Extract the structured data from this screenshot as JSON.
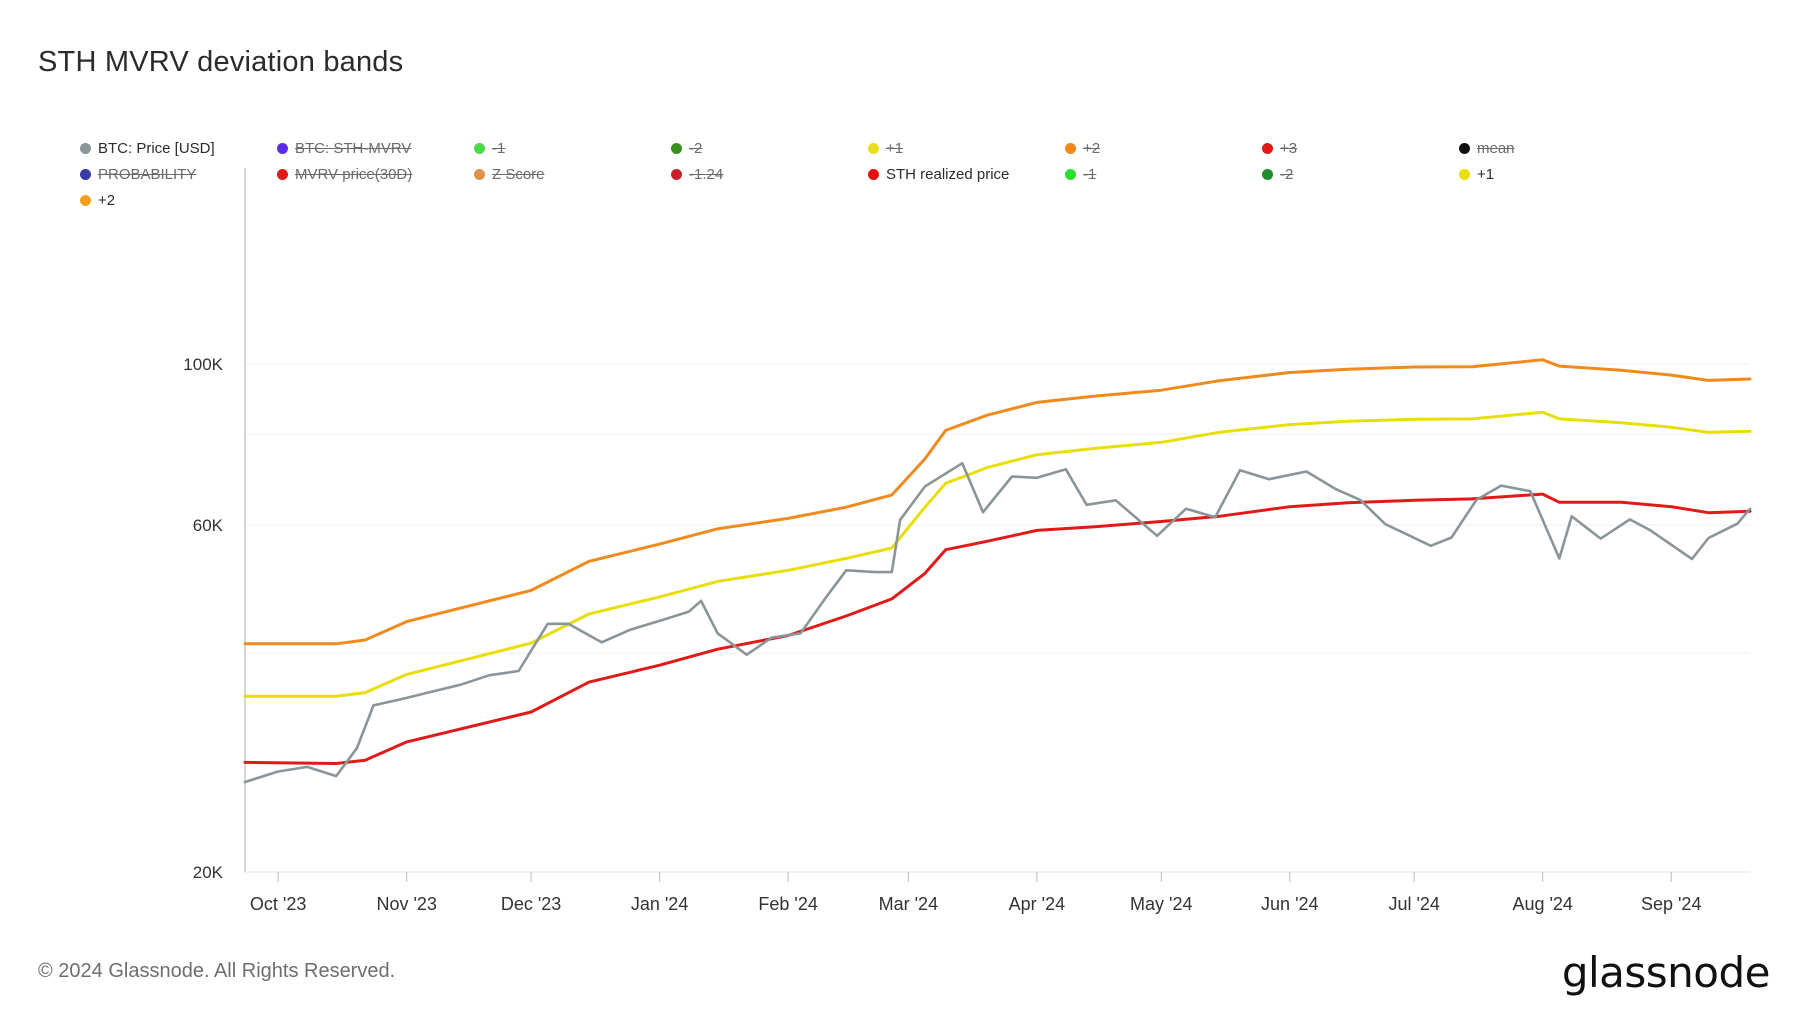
{
  "title": "STH MVRV deviation bands",
  "legend": [
    {
      "label": "BTC: Price [USD]",
      "color": "#8a9599",
      "active": true
    },
    {
      "label": "BTC: STH-MVRV",
      "color": "#5b2de0",
      "active": false
    },
    {
      "label": "-1",
      "color": "#4cd94c",
      "active": false
    },
    {
      "label": "-2",
      "color": "#3a8f1e",
      "active": false
    },
    {
      "label": "+1",
      "color": "#e8de1e",
      "active": false
    },
    {
      "label": "+2",
      "color": "#f08a1c",
      "active": false
    },
    {
      "label": "+3",
      "color": "#e01919",
      "active": false
    },
    {
      "label": "mean",
      "color": "#111111",
      "active": false
    },
    {
      "label": "PROBABILITY",
      "color": "#3a3aa8",
      "active": false
    },
    {
      "label": "MVRV price(30D)",
      "color": "#e01919",
      "active": false
    },
    {
      "label": "Z Score",
      "color": "#e0934a",
      "active": false
    },
    {
      "label": "-1.24",
      "color": "#c9202a",
      "active": false
    },
    {
      "label": "STH realized price",
      "color": "#e80d0d",
      "active": true
    },
    {
      "label": "-1",
      "color": "#2be02b",
      "active": false
    },
    {
      "label": "-2",
      "color": "#1c8f2b",
      "active": false
    },
    {
      "label": "+1",
      "color": "#e8de0a",
      "active": true
    },
    {
      "label": "+2",
      "color": "#f5a01c",
      "active": true
    }
  ],
  "chart_data": {
    "type": "line",
    "title": "STH MVRV deviation bands",
    "y_scale": "log",
    "ylim": [
      20000,
      200000
    ],
    "y_ticks": [
      {
        "value": 20000,
        "label": "20K"
      },
      {
        "value": 60000,
        "label": "60K"
      },
      {
        "value": 100000,
        "label": "100K"
      }
    ],
    "x_ticks": [
      "Oct '23",
      "Nov '23",
      "Dec '23",
      "Jan '24",
      "Feb '24",
      "Mar '24",
      "Apr '24",
      "May '24",
      "Jun '24",
      "Jul '24",
      "Aug '24",
      "Sep '24"
    ],
    "xlim": [
      "2023-09-23",
      "2024-09-20"
    ],
    "grid": true,
    "series": [
      {
        "name": "BTC: Price [USD]",
        "color": "#8a9599",
        "points": [
          [
            "2023-09-23",
            26600
          ],
          [
            "2023-10-01",
            27500
          ],
          [
            "2023-10-08",
            27900
          ],
          [
            "2023-10-15",
            27100
          ],
          [
            "2023-10-20",
            29600
          ],
          [
            "2023-10-24",
            33900
          ],
          [
            "2023-10-31",
            34600
          ],
          [
            "2023-11-07",
            35400
          ],
          [
            "2023-11-14",
            36200
          ],
          [
            "2023-11-21",
            37300
          ],
          [
            "2023-11-28",
            37800
          ],
          [
            "2023-12-05",
            43900
          ],
          [
            "2023-12-10",
            43900
          ],
          [
            "2023-12-18",
            41400
          ],
          [
            "2023-12-25",
            43100
          ],
          [
            "2024-01-01",
            44300
          ],
          [
            "2024-01-08",
            45600
          ],
          [
            "2024-01-11",
            47200
          ],
          [
            "2024-01-15",
            42600
          ],
          [
            "2024-01-22",
            39800
          ],
          [
            "2024-01-28",
            42000
          ],
          [
            "2024-02-04",
            42600
          ],
          [
            "2024-02-10",
            47600
          ],
          [
            "2024-02-15",
            52000
          ],
          [
            "2024-02-22",
            51700
          ],
          [
            "2024-02-26",
            51700
          ],
          [
            "2024-02-28",
            61000
          ],
          [
            "2024-03-05",
            67800
          ],
          [
            "2024-03-14",
            73000
          ],
          [
            "2024-03-19",
            62500
          ],
          [
            "2024-03-26",
            70000
          ],
          [
            "2024-04-01",
            69700
          ],
          [
            "2024-04-08",
            71600
          ],
          [
            "2024-04-13",
            64000
          ],
          [
            "2024-04-20",
            64900
          ],
          [
            "2024-04-30",
            58000
          ],
          [
            "2024-05-07",
            63200
          ],
          [
            "2024-05-14",
            61500
          ],
          [
            "2024-05-20",
            71400
          ],
          [
            "2024-05-27",
            69400
          ],
          [
            "2024-06-05",
            71100
          ],
          [
            "2024-06-12",
            67300
          ],
          [
            "2024-06-18",
            65000
          ],
          [
            "2024-06-24",
            60200
          ],
          [
            "2024-07-05",
            56200
          ],
          [
            "2024-07-10",
            57700
          ],
          [
            "2024-07-16",
            65000
          ],
          [
            "2024-07-22",
            68000
          ],
          [
            "2024-07-29",
            66800
          ],
          [
            "2024-08-05",
            54000
          ],
          [
            "2024-08-08",
            61700
          ],
          [
            "2024-08-15",
            57500
          ],
          [
            "2024-08-22",
            61100
          ],
          [
            "2024-08-27",
            59000
          ],
          [
            "2024-09-06",
            53900
          ],
          [
            "2024-09-10",
            57600
          ],
          [
            "2024-09-17",
            60300
          ],
          [
            "2024-09-20",
            63200
          ]
        ]
      },
      {
        "name": "STH realized price",
        "color": "#e01919",
        "points": [
          [
            "2023-09-23",
            28300
          ],
          [
            "2023-10-15",
            28200
          ],
          [
            "2023-10-22",
            28500
          ],
          [
            "2023-11-01",
            30200
          ],
          [
            "2023-12-01",
            33200
          ],
          [
            "2023-12-15",
            36500
          ],
          [
            "2024-01-01",
            38500
          ],
          [
            "2024-01-15",
            40500
          ],
          [
            "2024-02-01",
            42300
          ],
          [
            "2024-02-15",
            45000
          ],
          [
            "2024-02-26",
            47500
          ],
          [
            "2024-03-05",
            51500
          ],
          [
            "2024-03-10",
            55500
          ],
          [
            "2024-03-20",
            57000
          ],
          [
            "2024-04-01",
            59000
          ],
          [
            "2024-04-15",
            59700
          ],
          [
            "2024-05-01",
            60700
          ],
          [
            "2024-05-15",
            61700
          ],
          [
            "2024-06-01",
            63600
          ],
          [
            "2024-06-15",
            64400
          ],
          [
            "2024-07-01",
            64900
          ],
          [
            "2024-07-15",
            65200
          ],
          [
            "2024-08-01",
            66200
          ],
          [
            "2024-08-05",
            64500
          ],
          [
            "2024-08-20",
            64500
          ],
          [
            "2024-09-01",
            63600
          ],
          [
            "2024-09-10",
            62400
          ],
          [
            "2024-09-20",
            62700
          ]
        ]
      },
      {
        "name": "+1",
        "color": "#e8de0a",
        "points": [
          [
            "2023-09-23",
            34900
          ],
          [
            "2023-10-15",
            34900
          ],
          [
            "2023-10-22",
            35300
          ],
          [
            "2023-11-01",
            37400
          ],
          [
            "2023-12-01",
            41300
          ],
          [
            "2023-12-15",
            45300
          ],
          [
            "2024-01-01",
            47800
          ],
          [
            "2024-01-15",
            50200
          ],
          [
            "2024-02-01",
            52000
          ],
          [
            "2024-02-15",
            54000
          ],
          [
            "2024-02-26",
            55800
          ],
          [
            "2024-03-05",
            63500
          ],
          [
            "2024-03-10",
            68500
          ],
          [
            "2024-03-20",
            72000
          ],
          [
            "2024-04-01",
            75000
          ],
          [
            "2024-04-15",
            76500
          ],
          [
            "2024-05-01",
            78000
          ],
          [
            "2024-05-15",
            80500
          ],
          [
            "2024-06-01",
            82500
          ],
          [
            "2024-06-15",
            83400
          ],
          [
            "2024-07-01",
            83900
          ],
          [
            "2024-07-15",
            84000
          ],
          [
            "2024-08-01",
            85800
          ],
          [
            "2024-08-05",
            84000
          ],
          [
            "2024-08-20",
            83000
          ],
          [
            "2024-09-01",
            81800
          ],
          [
            "2024-09-10",
            80500
          ],
          [
            "2024-09-20",
            80800
          ]
        ]
      },
      {
        "name": "+2",
        "color": "#f08a1c",
        "points": [
          [
            "2023-09-23",
            41200
          ],
          [
            "2023-10-15",
            41200
          ],
          [
            "2023-10-22",
            41700
          ],
          [
            "2023-11-01",
            44200
          ],
          [
            "2023-12-01",
            48800
          ],
          [
            "2023-12-15",
            53500
          ],
          [
            "2024-01-01",
            56500
          ],
          [
            "2024-01-15",
            59300
          ],
          [
            "2024-02-01",
            61300
          ],
          [
            "2024-02-15",
            63500
          ],
          [
            "2024-02-26",
            66000
          ],
          [
            "2024-03-05",
            74000
          ],
          [
            "2024-03-10",
            81000
          ],
          [
            "2024-03-20",
            85000
          ],
          [
            "2024-04-01",
            88500
          ],
          [
            "2024-04-15",
            90300
          ],
          [
            "2024-05-01",
            92000
          ],
          [
            "2024-05-15",
            94800
          ],
          [
            "2024-06-01",
            97300
          ],
          [
            "2024-06-15",
            98300
          ],
          [
            "2024-07-01",
            99000
          ],
          [
            "2024-07-15",
            99100
          ],
          [
            "2024-08-01",
            101300
          ],
          [
            "2024-08-05",
            99300
          ],
          [
            "2024-08-20",
            98000
          ],
          [
            "2024-09-01",
            96500
          ],
          [
            "2024-09-10",
            94900
          ],
          [
            "2024-09-20",
            95300
          ]
        ]
      }
    ]
  },
  "footer": {
    "copyright": "© 2024 Glassnode. All Rights Reserved.",
    "logo": "glassnode"
  }
}
